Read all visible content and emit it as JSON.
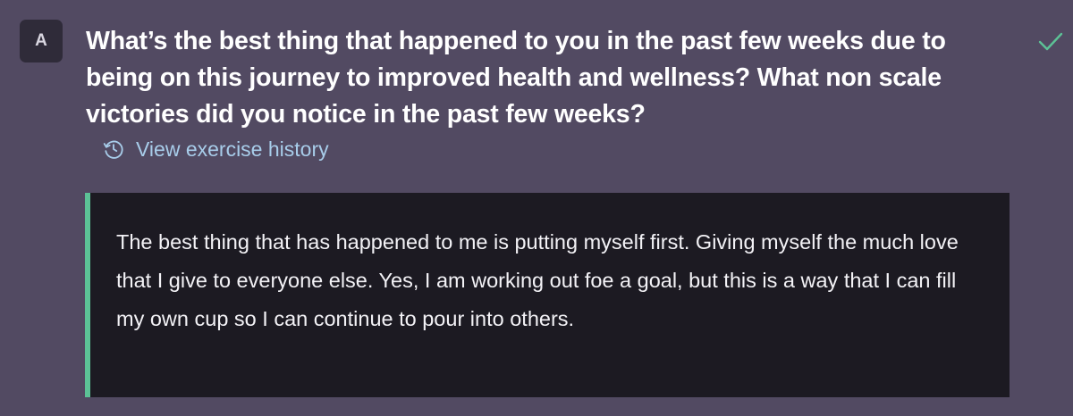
{
  "avatar": {
    "letter": "A"
  },
  "question": {
    "text": "What’s the best thing that happened to you in the past few weeks due to being on this journey to improved health and wellness? What non scale victories did you notice in the past few weeks?",
    "status_icon": "checkmark-icon",
    "status_color": "#5cc296"
  },
  "history_link": {
    "icon": "history-icon",
    "label": "View exercise history",
    "color": "#a8cdea"
  },
  "answer": {
    "text": "The best thing that has happened to me is putting myself first. Giving myself the much love that I give to everyone else. Yes, I am working out foe a goal, but this is a way that I can fill my own cup so I can continue to pour into others.",
    "accent_color": "#5cc296"
  }
}
